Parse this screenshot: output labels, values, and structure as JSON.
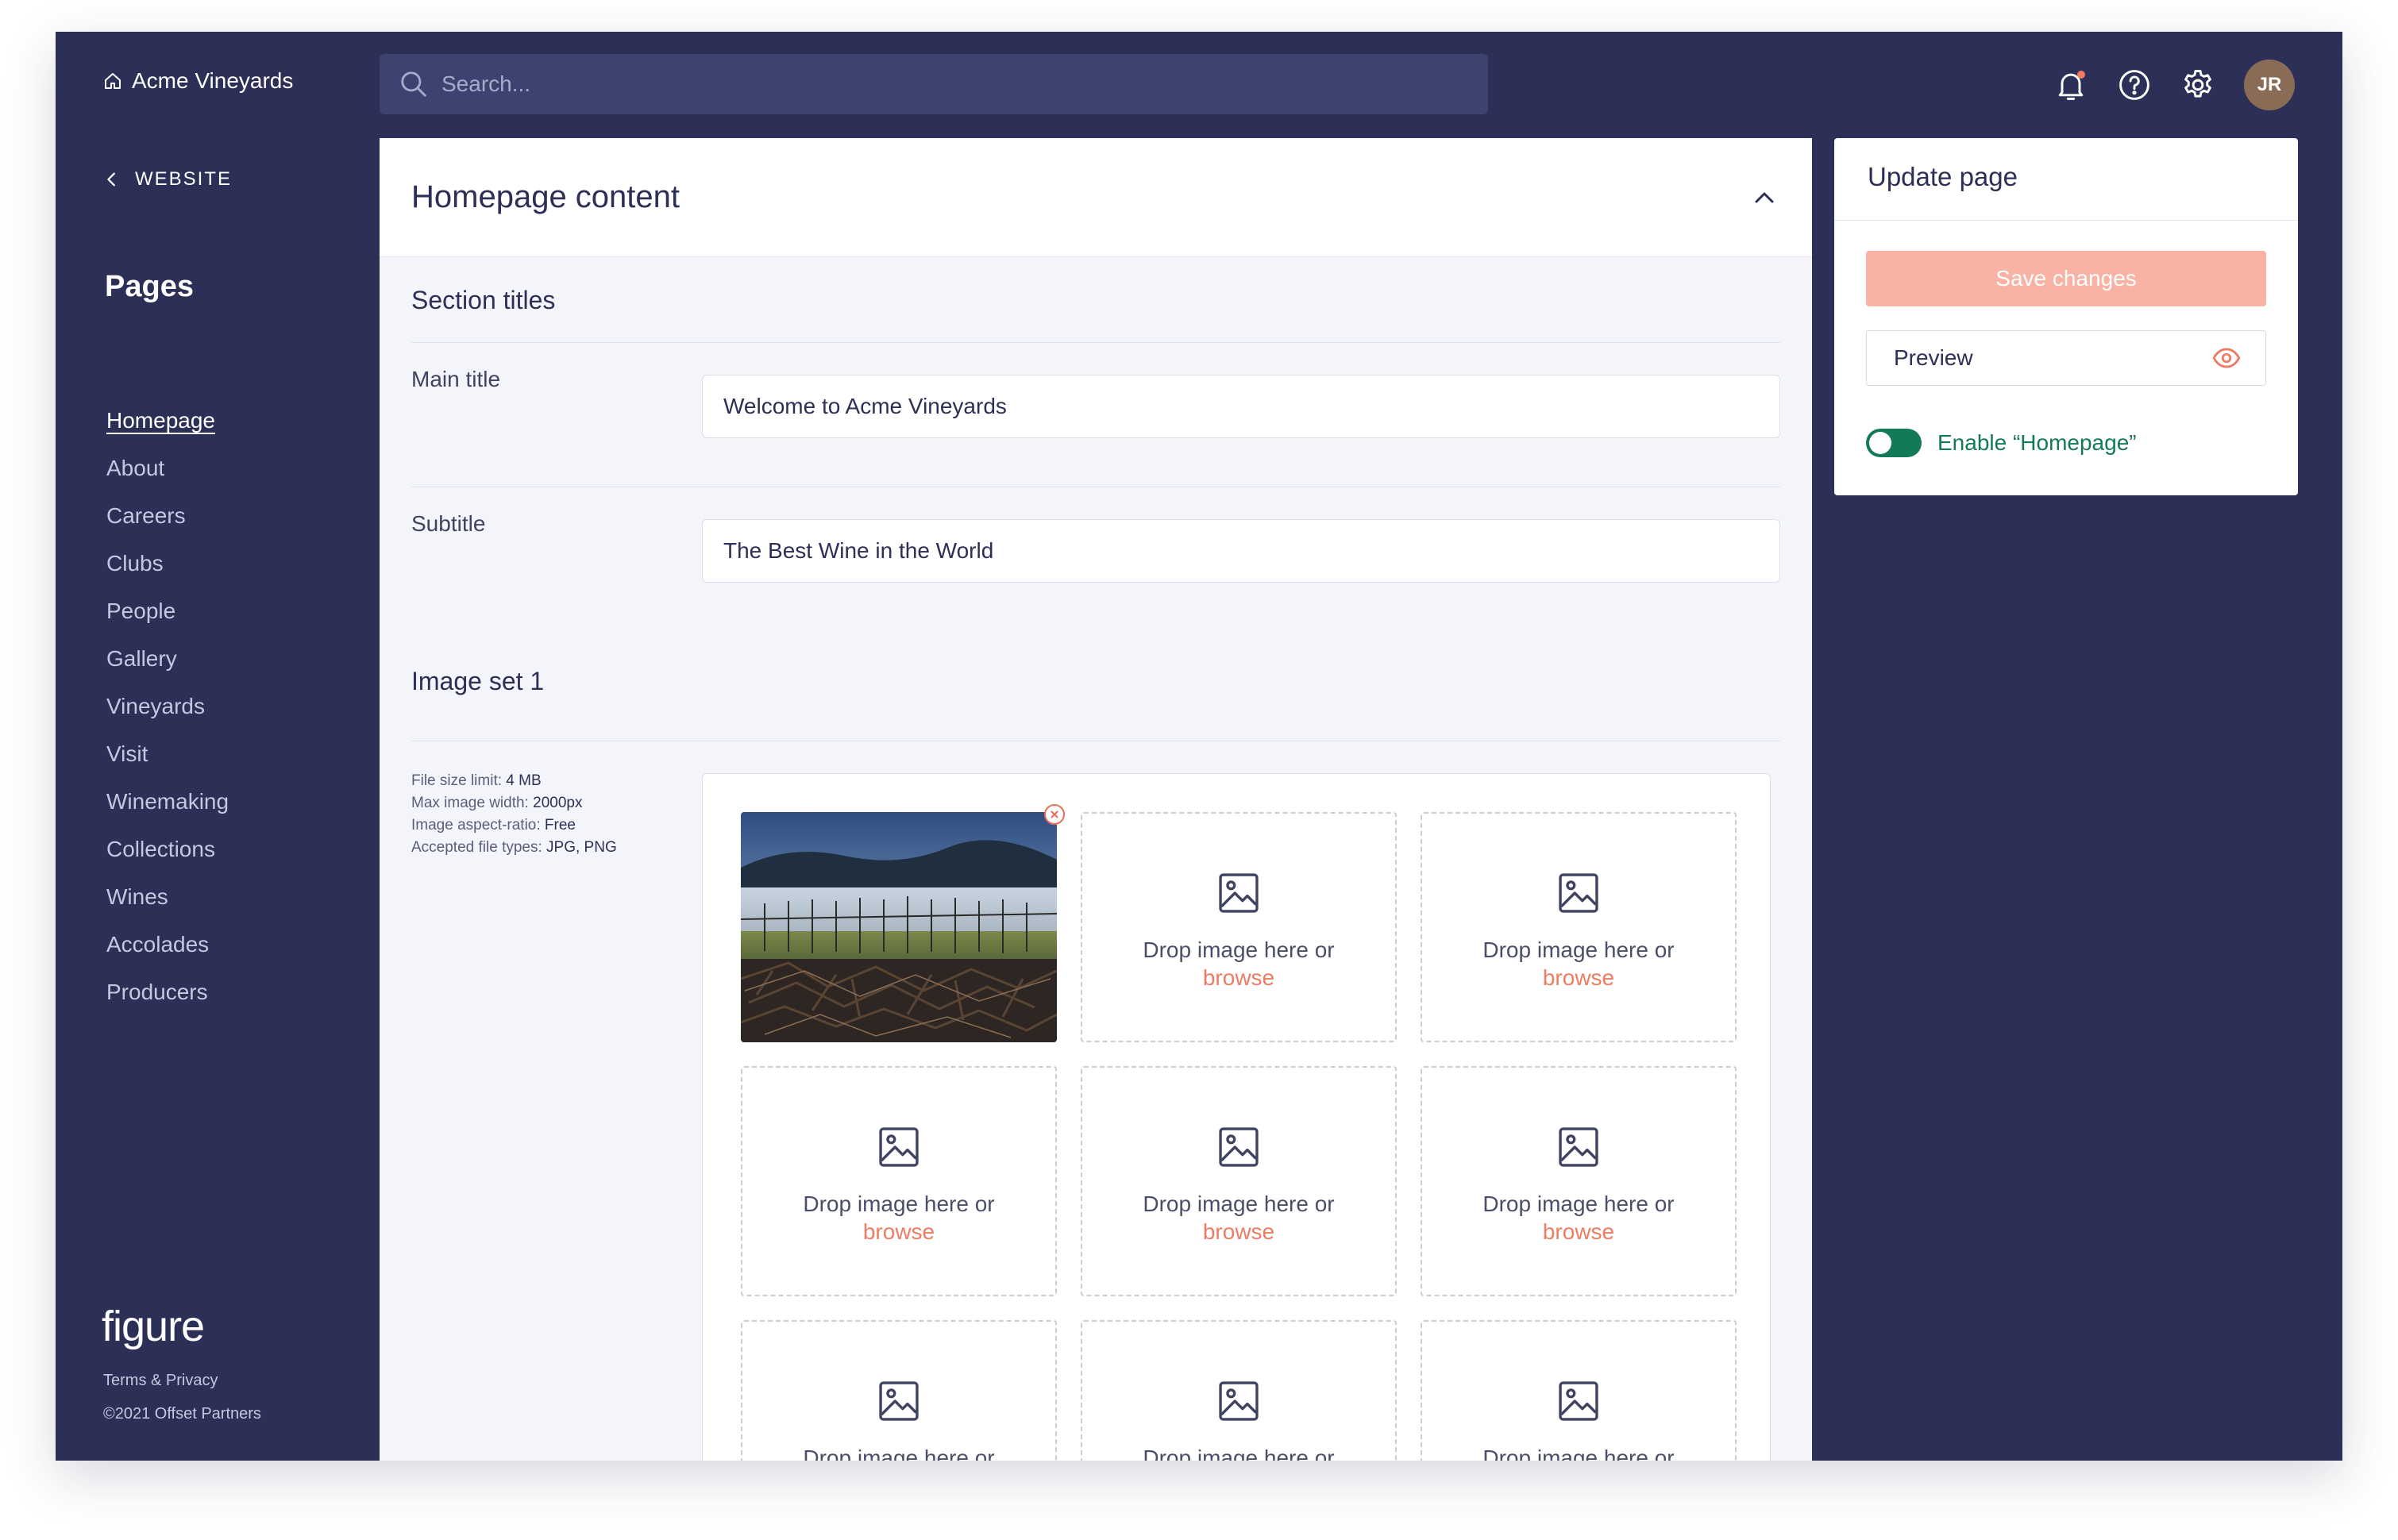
{
  "brand": {
    "name": "Acme Vineyards",
    "icon": "home-icon"
  },
  "back": {
    "label": "WEBSITE",
    "icon": "chevron-left-icon"
  },
  "sidebar": {
    "heading": "Pages",
    "items": [
      {
        "label": "Homepage",
        "active": true
      },
      {
        "label": "About"
      },
      {
        "label": "Careers"
      },
      {
        "label": "Clubs"
      },
      {
        "label": "People"
      },
      {
        "label": "Gallery"
      },
      {
        "label": "Vineyards"
      },
      {
        "label": "Visit"
      },
      {
        "label": "Winemaking"
      },
      {
        "label": "Collections"
      },
      {
        "label": "Wines"
      },
      {
        "label": "Accolades"
      },
      {
        "label": "Producers"
      }
    ],
    "footer": {
      "logo": "figure",
      "terms": "Terms & Privacy",
      "copyright": "©2021 Offset Partners"
    }
  },
  "search": {
    "placeholder": "Search...",
    "icon": "search-icon"
  },
  "topbar": {
    "icons": [
      "bell-icon",
      "help-icon",
      "gear-icon"
    ],
    "avatar_initials": "JR"
  },
  "main": {
    "title": "Homepage content",
    "section_titles": {
      "heading": "Section titles",
      "main_title_label": "Main title",
      "main_title_value": "Welcome to Acme Vineyards",
      "subtitle_label": "Subtitle",
      "subtitle_value": "The Best Wine in the World"
    },
    "image_set": {
      "heading": "Image set 1",
      "info": {
        "file_size_label": "File size limit:",
        "file_size_value": "4 MB",
        "max_width_label": "Max image width:",
        "max_width_value": "2000px",
        "aspect_label": "Image aspect-ratio:",
        "aspect_value": "Free",
        "types_label": "Accepted file types:",
        "types_value": "JPG, PNG"
      },
      "drop_text": "Drop image here or",
      "browse_text": "browse"
    }
  },
  "update_panel": {
    "title": "Update page",
    "save_label": "Save changes",
    "preview_label": "Preview",
    "toggle_label": "Enable “Homepage”",
    "toggle_on": true
  },
  "colors": {
    "navy": "#2c2f56",
    "accent": "#ef7b63",
    "save_disabled": "#f9b2a3",
    "success": "#137a57"
  }
}
